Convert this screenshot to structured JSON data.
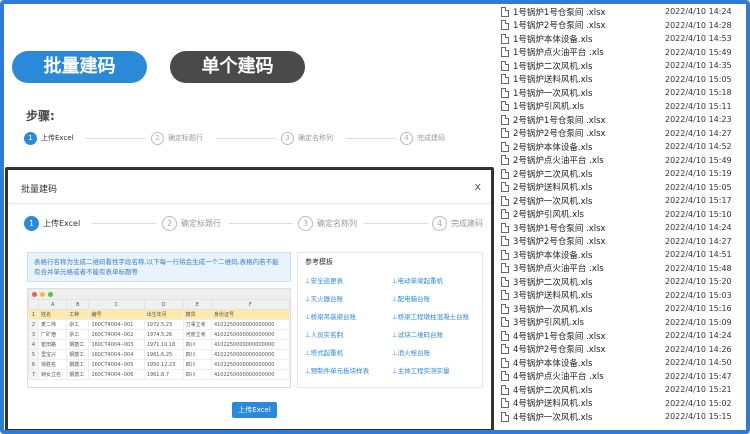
{
  "buttons": {
    "batch_label": "批量建码",
    "single_label": "单个建码"
  },
  "steps_title": "步骤:",
  "steps": [
    {
      "num": "1",
      "label": "上传Excel"
    },
    {
      "num": "2",
      "label": "确定标题行"
    },
    {
      "num": "3",
      "label": "确定名称列"
    },
    {
      "num": "4",
      "label": "完成建码"
    }
  ],
  "dialog": {
    "title": "批量建码",
    "close": "x",
    "notice": "表格行名称为生成二维码看性字段名称,以下每一行将会生成一个二维码,表格内若不能有合并单元格或者不能有表单标题等",
    "upload_label": "上传Excel",
    "ref_title": "参考模板",
    "ref_links": [
      "⊥安全巡更表",
      "⊥电动单梁起重机",
      "⊥灭火器台账",
      "⊥配电箱台账",
      "⊥桥梁吊装梁台账",
      "⊥桥梁工程墩柱混凝土台账",
      "⊥人员实名制",
      "⊥试块二维码台账",
      "⊥塔式起重机",
      "⊥消火栓台账",
      "⊥预制件单元板块样表",
      "⊥主体工程实测实量"
    ],
    "sheet": {
      "cols": [
        "A",
        "B",
        "C",
        "D",
        "E",
        "F"
      ],
      "rows": [
        [
          "姓名",
          "工种",
          "编号",
          "出生年月",
          "籍贯",
          "身份证号"
        ],
        [
          "麦二伟",
          "杂工",
          "160CT4004--001",
          "1972.5.23",
          "刀事立考",
          "4102250000000000000"
        ],
        [
          "广矿宿",
          "杂工",
          "160CT4004--002",
          "1974.5.26",
          "河度立考",
          "4102250000000000000"
        ],
        [
          "崔田路",
          "钢筋工",
          "160CT4004--003",
          "1971.10.18",
          "四川",
          "4102250000000000000"
        ],
        [
          "里宝兴",
          "钢筋工",
          "160CT4004--004",
          "1961.6.25",
          "四川",
          "4102250000000000000"
        ],
        [
          "徐胜名",
          "钢筋工",
          "160CT4004--005",
          "1950.12.23",
          "四川",
          "4102250000000000000"
        ],
        [
          "钟女立名",
          "钢筋工",
          "160CT4004--006",
          "1961.8.7",
          "四川",
          "4102250000000000000"
        ]
      ]
    }
  },
  "files": [
    {
      "name": "1号锅炉1号仓泵间 .xlsx",
      "date": "2022/4/10 14:24"
    },
    {
      "name": "1号锅炉2号仓泵间 .xlsx",
      "date": "2022/4/10 14:28"
    },
    {
      "name": "1号锅炉本体设备.xls",
      "date": "2022/4/10 14:53"
    },
    {
      "name": "1号锅炉点火油平台 .xls",
      "date": "2022/4/10 15:49"
    },
    {
      "name": "1号锅炉二次风机.xls",
      "date": "2022/4/10 14:35"
    },
    {
      "name": "1号锅炉送料风机.xls",
      "date": "2022/4/10 15:05"
    },
    {
      "name": "1号锅炉一次风机.xls",
      "date": "2022/4/10 15:18"
    },
    {
      "name": "1号锅炉引风机.xls",
      "date": "2022/4/10 15:11"
    },
    {
      "name": "2号锅炉1号仓泵间 .xlsx",
      "date": "2022/4/10 14:23"
    },
    {
      "name": "2号锅炉2号仓泵间 .xlsx",
      "date": "2022/4/10 14:27"
    },
    {
      "name": "2号锅炉本体设备.xls",
      "date": "2022/4/10 14:52"
    },
    {
      "name": "2号锅炉点火油平台 .xls",
      "date": "2022/4/10 15:49"
    },
    {
      "name": "2号锅炉二次风机.xls",
      "date": "2022/4/10 15:19"
    },
    {
      "name": "2号锅炉送料风机.xls",
      "date": "2022/4/10 15:05"
    },
    {
      "name": "2号锅炉一次风机.xls",
      "date": "2022/4/10 15:17"
    },
    {
      "name": "2号锅炉引风机.xls",
      "date": "2022/4/10 15:10"
    },
    {
      "name": "3号锅炉1号仓泵间 .xlsx",
      "date": "2022/4/10 14:24"
    },
    {
      "name": "3号锅炉2号仓泵间 .xlsx",
      "date": "2022/4/10 14:27"
    },
    {
      "name": "3号锅炉本体设备.xls",
      "date": "2022/4/10 14:51"
    },
    {
      "name": "3号锅炉点火油平台 .xls",
      "date": "2022/4/10 15:48"
    },
    {
      "name": "3号锅炉二次风机.xls",
      "date": "2022/4/10 15:20"
    },
    {
      "name": "3号锅炉送料风机.xls",
      "date": "2022/4/10 15:03"
    },
    {
      "name": "3号锅炉一次风机.xls",
      "date": "2022/4/10 15:16"
    },
    {
      "name": "3号锅炉引风机.xls",
      "date": "2022/4/10 15:09"
    },
    {
      "name": "4号锅炉1号仓泵间 .xlsx",
      "date": "2022/4/10 14:24"
    },
    {
      "name": "4号锅炉2号仓泵间 .xlsx",
      "date": "2022/4/10 14:26"
    },
    {
      "name": "4号锅炉本体设备.xls",
      "date": "2022/4/10 14:50"
    },
    {
      "name": "4号锅炉点火油平台 .xls",
      "date": "2022/4/10 15:47"
    },
    {
      "name": "4号锅炉二次风机.xls",
      "date": "2022/4/10 15:21"
    },
    {
      "name": "4号锅炉送料风机.xls",
      "date": "2022/4/10 15:02"
    },
    {
      "name": "4号锅炉一次风机.xls",
      "date": "2022/4/10 15:15"
    }
  ]
}
